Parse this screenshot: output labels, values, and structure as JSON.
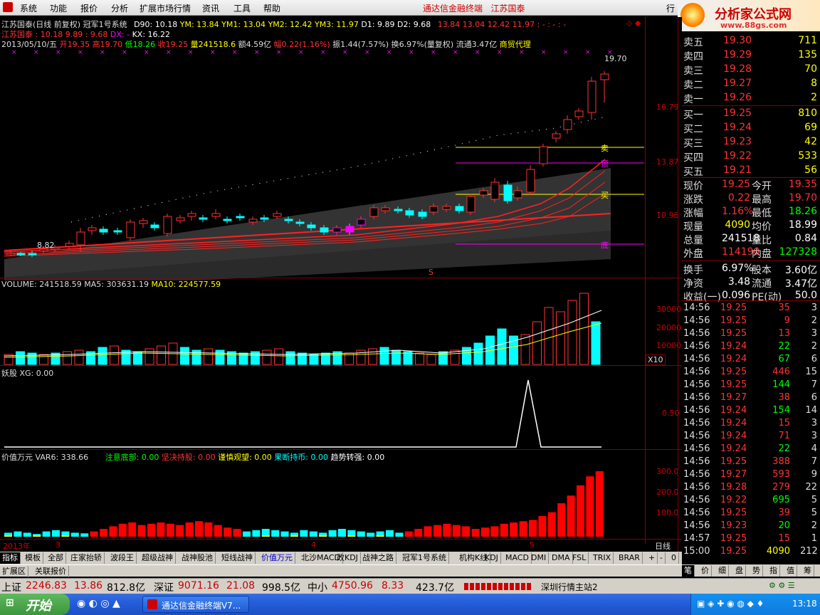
{
  "menu": {
    "items": [
      "系统",
      "功能",
      "报价",
      "分析",
      "扩展市场行情",
      "资讯",
      "工具",
      "帮助"
    ],
    "center_title": "通达信金融终端",
    "center_stock": "江苏国泰",
    "right_label": "行",
    "brand": "分析家公式网",
    "brand_url": "www.88gs.com"
  },
  "main_chart": {
    "header1": "江苏国泰(日线 前复权) 冠军1号系统",
    "d90": "D90: 10.18",
    "ym": "YM: 13.84",
    "ym1": "YM1: 13.04",
    "ym2": "YM2: 12.42",
    "ym3": "YM3: 11.97",
    "d1": "D1: 9.89",
    "d2": "D2: 9.68",
    "tail_values": "13.84  13.04  12.42  11.97  : -  : -  : -",
    "header2_a": "江苏国泰 : 10.18",
    "header2_b": "9.89 : 9.68",
    "header2_dx": "DX: -",
    "header2_kx": "KX: 16.22",
    "date": "2013/05/10/五",
    "open": "开19.35",
    "high": "高19.70",
    "low": "低18.26",
    "close": "收19.25",
    "vol": "量241518.6",
    "amount": "额4.59亿",
    "change": "幅0.22(1.16%)",
    "amp": "振1.44(7.57%)",
    "turnover": "换6.97%(量复权)",
    "float": "流通3.47亿",
    "sector": "商贸代理",
    "price_labels": [
      "16.79",
      "13.87",
      "10.96"
    ],
    "max_label": "19.70",
    "min_label": "8.82",
    "sell_label": "卖",
    "top_label": "顶",
    "buy_label": "买",
    "bottom_label": "底",
    "s_mark": "S"
  },
  "volume": {
    "header": "VOLUME: 241518.59",
    "ma5": "MA5: 303631.19",
    "ma10": "MA10: 224577.59",
    "labels": [
      "30000",
      "20000",
      "10000"
    ],
    "unit": "X10"
  },
  "yaogu": {
    "header": "妖股 XG: 0.00",
    "label": "0.50"
  },
  "value": {
    "header": "价值万元 VAR6: 338.66",
    "i1": "注意底部: 0.00",
    "i2": "坚决持股: 0.00",
    "i3": "谨慎观望: 0.00",
    "i4": "果断持币: 0.00",
    "i5": "趋势转强: 0.00",
    "labels": [
      "300.0",
      "200.0",
      "100.0"
    ]
  },
  "time_axis": {
    "year": "2013年",
    "m3": "3",
    "m4": "4",
    "m5": "5",
    "period": "日线"
  },
  "orderbook": {
    "sells": [
      {
        "label": "卖五",
        "price": "19.30",
        "vol": "711"
      },
      {
        "label": "卖四",
        "price": "19.29",
        "vol": "135"
      },
      {
        "label": "卖三",
        "price": "19.28",
        "vol": "70"
      },
      {
        "label": "卖二",
        "price": "19.27",
        "vol": "8"
      },
      {
        "label": "卖一",
        "price": "19.26",
        "vol": "2"
      }
    ],
    "buys": [
      {
        "label": "买一",
        "price": "19.25",
        "vol": "810"
      },
      {
        "label": "买二",
        "price": "19.24",
        "vol": "69"
      },
      {
        "label": "买三",
        "price": "19.23",
        "vol": "42"
      },
      {
        "label": "买四",
        "price": "19.22",
        "vol": "533"
      },
      {
        "label": "买五",
        "price": "19.21",
        "vol": "56"
      }
    ]
  },
  "quote": [
    {
      "l1": "现价",
      "v1": "19.25",
      "l2": "今开",
      "v2": "19.35"
    },
    {
      "l1": "涨跌",
      "v1": "0.22",
      "l2": "最高",
      "v2": "19.70"
    },
    {
      "l1": "涨幅",
      "v1": "1.16%",
      "l2": "最低",
      "v2": "18.26"
    },
    {
      "l1": "现量",
      "v1": "4090",
      "l2": "均价",
      "v2": "18.99"
    },
    {
      "l1": "总量",
      "v1": "241518",
      "l2": "量比",
      "v2": "0.84"
    },
    {
      "l1": "外盘",
      "v1": "114190",
      "l2": "内盘",
      "v2": "127328"
    },
    {
      "l1": "换手",
      "v1": "6.97%",
      "l2": "股本",
      "v2": "3.60亿"
    },
    {
      "l1": "净资",
      "v1": "3.48",
      "l2": "流通",
      "v2": "3.47亿"
    },
    {
      "l1": "收益(一)",
      "v1": "0.096",
      "l2": "PE(动)",
      "v2": "50.0"
    }
  ],
  "ticks": [
    {
      "t": "14:56",
      "p": "19.25",
      "v": "35",
      "n": "3"
    },
    {
      "t": "14:56",
      "p": "19.25",
      "v": "9",
      "n": "2"
    },
    {
      "t": "14:56",
      "p": "19.25",
      "v": "13",
      "n": "3"
    },
    {
      "t": "14:56",
      "p": "19.24",
      "v": "22",
      "n": "2"
    },
    {
      "t": "14:56",
      "p": "19.24",
      "v": "67",
      "n": "6"
    },
    {
      "t": "14:56",
      "p": "19.25",
      "v": "446",
      "n": "15"
    },
    {
      "t": "14:56",
      "p": "19.25",
      "v": "144",
      "n": "7"
    },
    {
      "t": "14:56",
      "p": "19.27",
      "v": "38",
      "n": "6"
    },
    {
      "t": "14:56",
      "p": "19.24",
      "v": "154",
      "n": "14"
    },
    {
      "t": "14:56",
      "p": "19.24",
      "v": "15",
      "n": "3"
    },
    {
      "t": "14:56",
      "p": "19.24",
      "v": "71",
      "n": "3"
    },
    {
      "t": "14:56",
      "p": "19.24",
      "v": "22",
      "n": "4"
    },
    {
      "t": "14:56",
      "p": "19.25",
      "v": "388",
      "n": "7"
    },
    {
      "t": "14:56",
      "p": "19.27",
      "v": "593",
      "n": "9"
    },
    {
      "t": "14:56",
      "p": "19.28",
      "v": "279",
      "n": "22"
    },
    {
      "t": "14:56",
      "p": "19.22",
      "v": "695",
      "n": "5"
    },
    {
      "t": "14:56",
      "p": "19.25",
      "v": "39",
      "n": "5"
    },
    {
      "t": "14:56",
      "p": "19.23",
      "v": "20",
      "n": "2"
    },
    {
      "t": "14:57",
      "p": "19.25",
      "v": "15",
      "n": "1"
    },
    {
      "t": "15:00",
      "p": "19.25",
      "v": "4090",
      "n": "212"
    }
  ],
  "tabs": [
    "指标",
    "模板",
    "全部",
    "庄家抬轿",
    "波段王",
    "超级战神",
    "战神股池",
    "短线战神",
    "价值万元",
    "北沙MACD",
    "改KDJ",
    "战神之路",
    "冠军1号系统",
    "机构K线",
    "KDJ",
    "MACD",
    "DMI",
    "DMA",
    "FSL",
    "TRIX",
    "BRAR"
  ],
  "tabs2": [
    "扩展区",
    "关联报价"
  ],
  "right_tabs": [
    "笔",
    "价",
    "细",
    "盘",
    "势",
    "指",
    "值",
    "筹"
  ],
  "tab_controls": [
    "+",
    "-",
    "0"
  ],
  "status": {
    "sh_label": "上证",
    "sh_val": "2246.83",
    "sh_chg": "13.86",
    "sh_amt": "812.8亿",
    "sz_label": "深证",
    "sz_val": "9071.16",
    "sz_chg": "21.08",
    "sz_amt": "998.5亿",
    "zx_label": "中小",
    "zx_val": "4750.96",
    "zx_chg": "8.33",
    "zx_amt": "423.7亿",
    "server": "深圳行情主站2"
  },
  "taskbar": {
    "start": "开始",
    "window": "通达信金融终端V7...",
    "clock": "13:18"
  },
  "colors": {
    "up": "#ff3232",
    "down": "#00ffff",
    "yellow": "#ffff00",
    "magenta": "#ff00ff",
    "green": "#00ff00"
  }
}
